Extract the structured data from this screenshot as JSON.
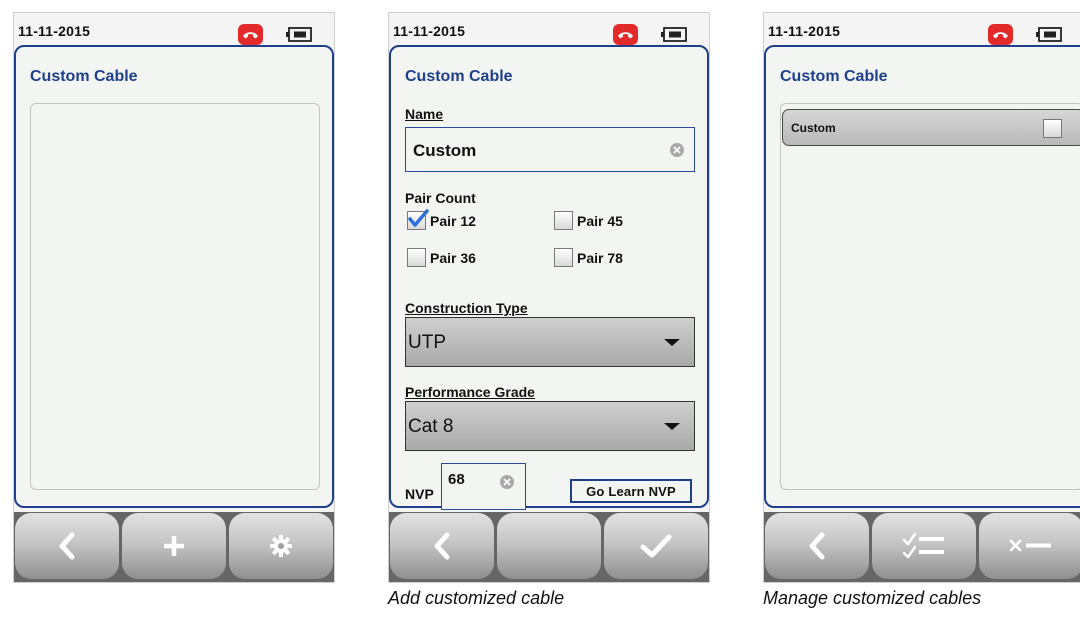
{
  "screens": [
    {
      "status": {
        "date": "11-11-2015"
      },
      "title": "Custom Cable",
      "toolbar": [
        "back",
        "add",
        "settings"
      ]
    },
    {
      "status": {
        "date": "11-11-2015"
      },
      "title": "Custom Cable",
      "name_label": "Name",
      "name_value": "Custom",
      "pair_count_label": "Pair Count",
      "pairs": [
        {
          "label": "Pair 12",
          "checked": true
        },
        {
          "label": "Pair 45",
          "checked": false
        },
        {
          "label": "Pair 36",
          "checked": false
        },
        {
          "label": "Pair 78",
          "checked": false
        }
      ],
      "construction_label": "Construction Type",
      "construction_value": "UTP",
      "grade_label": "Performance Grade",
      "grade_value": "Cat 8",
      "nvp_label": "NVP",
      "nvp_value": "68",
      "learn_button": "Go Learn NVP",
      "toolbar": [
        "back",
        "blank",
        "confirm"
      ]
    },
    {
      "status": {
        "date": "11-11-2015"
      },
      "title": "Custom Cable",
      "items": [
        {
          "label": "Custom",
          "checked": false
        }
      ],
      "toolbar": [
        "back",
        "select-all",
        "delete"
      ]
    }
  ],
  "captions": {
    "add": "Add customized cable",
    "manage": "Manage customized cables"
  },
  "icons": {
    "status": [
      "phone-icon",
      "battery-icon"
    ],
    "clear": "clear-icon"
  },
  "colors": {
    "accent": "#1f3f8c",
    "phone_red": "#e32a2a",
    "check_blue": "#2f6fd8"
  }
}
